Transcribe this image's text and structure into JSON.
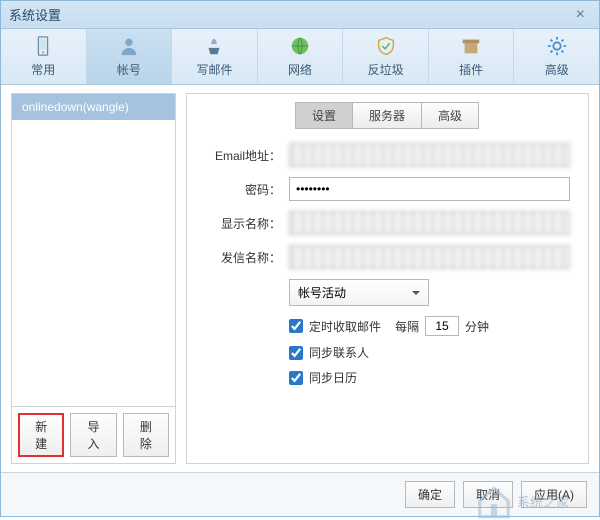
{
  "title": "系统设置",
  "toolbar": [
    {
      "key": "general",
      "label": "常用"
    },
    {
      "key": "account",
      "label": "帐号"
    },
    {
      "key": "compose",
      "label": "写邮件"
    },
    {
      "key": "network",
      "label": "网络"
    },
    {
      "key": "antispam",
      "label": "反垃圾"
    },
    {
      "key": "plugin",
      "label": "插件"
    },
    {
      "key": "advanced",
      "label": "高级"
    }
  ],
  "active_toolbar": "account",
  "accounts": [
    "onlinedown(wangle)"
  ],
  "left_buttons": {
    "new": "新建",
    "import": "导入",
    "delete": "删除"
  },
  "tabs": [
    {
      "key": "settings",
      "label": "设置"
    },
    {
      "key": "server",
      "label": "服务器"
    },
    {
      "key": "advanced",
      "label": "高级"
    }
  ],
  "active_tab": "settings",
  "form": {
    "email_label": "Email地址：",
    "password_label": "密码：",
    "password_value": "********",
    "display_name_label": "显示名称：",
    "sender_name_label": "发信名称：",
    "select_label": "帐号活动",
    "check_fetch": "定时收取邮件",
    "interval_prefix": "每隔",
    "interval_value": "15",
    "interval_suffix": "分钟",
    "check_sync_contacts": "同步联系人",
    "check_sync_calendar": "同步日历"
  },
  "footer": {
    "ok": "确定",
    "cancel": "取消",
    "apply": "应用(A)"
  },
  "watermark": "系统之家"
}
